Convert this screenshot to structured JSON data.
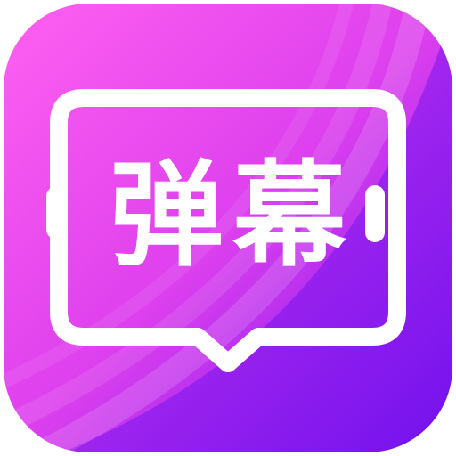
{
  "app_icon": {
    "label": "弹幕",
    "icon": "speech-bubble-icon",
    "colors": {
      "gradient_start": "#ff60f0",
      "gradient_mid": "#dd40ee",
      "gradient_end": "#6a10ee",
      "text": "#ffffff"
    }
  }
}
